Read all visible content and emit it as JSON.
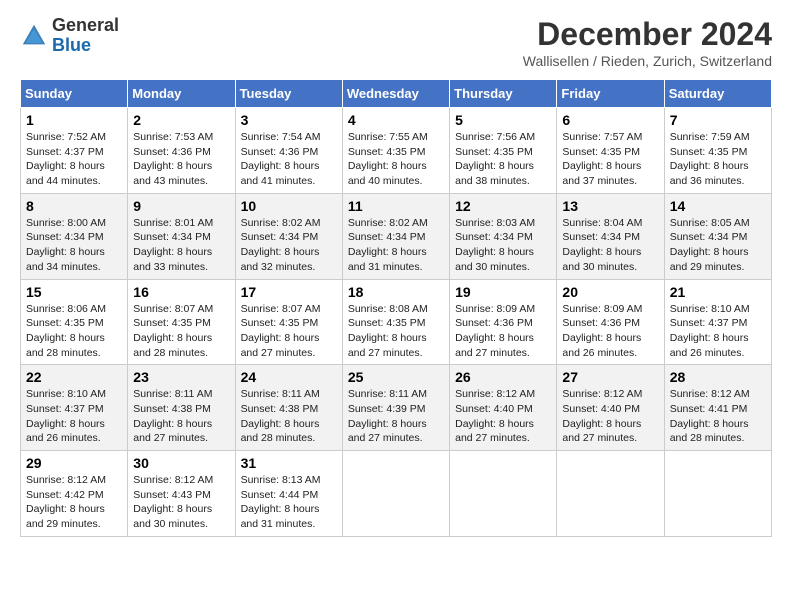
{
  "header": {
    "logo": {
      "general": "General",
      "blue": "Blue"
    },
    "title": "December 2024",
    "location": "Wallisellen / Rieden, Zurich, Switzerland"
  },
  "calendar": {
    "days_of_week": [
      "Sunday",
      "Monday",
      "Tuesday",
      "Wednesday",
      "Thursday",
      "Friday",
      "Saturday"
    ],
    "weeks": [
      [
        {
          "day": "1",
          "sunrise": "7:52 AM",
          "sunset": "4:37 PM",
          "daylight": "8 hours and 44 minutes."
        },
        {
          "day": "2",
          "sunrise": "7:53 AM",
          "sunset": "4:36 PM",
          "daylight": "8 hours and 43 minutes."
        },
        {
          "day": "3",
          "sunrise": "7:54 AM",
          "sunset": "4:36 PM",
          "daylight": "8 hours and 41 minutes."
        },
        {
          "day": "4",
          "sunrise": "7:55 AM",
          "sunset": "4:35 PM",
          "daylight": "8 hours and 40 minutes."
        },
        {
          "day": "5",
          "sunrise": "7:56 AM",
          "sunset": "4:35 PM",
          "daylight": "8 hours and 38 minutes."
        },
        {
          "day": "6",
          "sunrise": "7:57 AM",
          "sunset": "4:35 PM",
          "daylight": "8 hours and 37 minutes."
        },
        {
          "day": "7",
          "sunrise": "7:59 AM",
          "sunset": "4:35 PM",
          "daylight": "8 hours and 36 minutes."
        }
      ],
      [
        {
          "day": "8",
          "sunrise": "8:00 AM",
          "sunset": "4:34 PM",
          "daylight": "8 hours and 34 minutes."
        },
        {
          "day": "9",
          "sunrise": "8:01 AM",
          "sunset": "4:34 PM",
          "daylight": "8 hours and 33 minutes."
        },
        {
          "day": "10",
          "sunrise": "8:02 AM",
          "sunset": "4:34 PM",
          "daylight": "8 hours and 32 minutes."
        },
        {
          "day": "11",
          "sunrise": "8:02 AM",
          "sunset": "4:34 PM",
          "daylight": "8 hours and 31 minutes."
        },
        {
          "day": "12",
          "sunrise": "8:03 AM",
          "sunset": "4:34 PM",
          "daylight": "8 hours and 30 minutes."
        },
        {
          "day": "13",
          "sunrise": "8:04 AM",
          "sunset": "4:34 PM",
          "daylight": "8 hours and 30 minutes."
        },
        {
          "day": "14",
          "sunrise": "8:05 AM",
          "sunset": "4:34 PM",
          "daylight": "8 hours and 29 minutes."
        }
      ],
      [
        {
          "day": "15",
          "sunrise": "8:06 AM",
          "sunset": "4:35 PM",
          "daylight": "8 hours and 28 minutes."
        },
        {
          "day": "16",
          "sunrise": "8:07 AM",
          "sunset": "4:35 PM",
          "daylight": "8 hours and 28 minutes."
        },
        {
          "day": "17",
          "sunrise": "8:07 AM",
          "sunset": "4:35 PM",
          "daylight": "8 hours and 27 minutes."
        },
        {
          "day": "18",
          "sunrise": "8:08 AM",
          "sunset": "4:35 PM",
          "daylight": "8 hours and 27 minutes."
        },
        {
          "day": "19",
          "sunrise": "8:09 AM",
          "sunset": "4:36 PM",
          "daylight": "8 hours and 27 minutes."
        },
        {
          "day": "20",
          "sunrise": "8:09 AM",
          "sunset": "4:36 PM",
          "daylight": "8 hours and 26 minutes."
        },
        {
          "day": "21",
          "sunrise": "8:10 AM",
          "sunset": "4:37 PM",
          "daylight": "8 hours and 26 minutes."
        }
      ],
      [
        {
          "day": "22",
          "sunrise": "8:10 AM",
          "sunset": "4:37 PM",
          "daylight": "8 hours and 26 minutes."
        },
        {
          "day": "23",
          "sunrise": "8:11 AM",
          "sunset": "4:38 PM",
          "daylight": "8 hours and 27 minutes."
        },
        {
          "day": "24",
          "sunrise": "8:11 AM",
          "sunset": "4:38 PM",
          "daylight": "8 hours and 28 minutes."
        },
        {
          "day": "25",
          "sunrise": "8:11 AM",
          "sunset": "4:39 PM",
          "daylight": "8 hours and 27 minutes."
        },
        {
          "day": "26",
          "sunrise": "8:12 AM",
          "sunset": "4:40 PM",
          "daylight": "8 hours and 27 minutes."
        },
        {
          "day": "27",
          "sunrise": "8:12 AM",
          "sunset": "4:40 PM",
          "daylight": "8 hours and 27 minutes."
        },
        {
          "day": "28",
          "sunrise": "8:12 AM",
          "sunset": "4:41 PM",
          "daylight": "8 hours and 28 minutes."
        }
      ],
      [
        {
          "day": "29",
          "sunrise": "8:12 AM",
          "sunset": "4:42 PM",
          "daylight": "8 hours and 29 minutes."
        },
        {
          "day": "30",
          "sunrise": "8:12 AM",
          "sunset": "4:43 PM",
          "daylight": "8 hours and 30 minutes."
        },
        {
          "day": "31",
          "sunrise": "8:13 AM",
          "sunset": "4:44 PM",
          "daylight": "8 hours and 31 minutes."
        },
        null,
        null,
        null,
        null
      ]
    ]
  }
}
